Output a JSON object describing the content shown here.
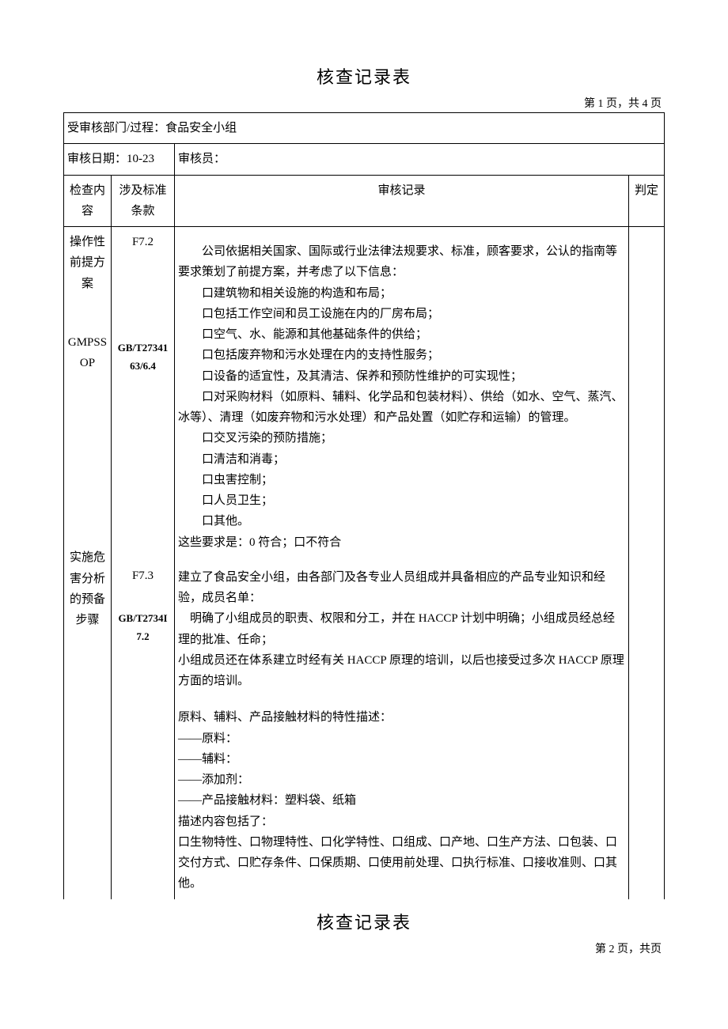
{
  "title": "核查记录表",
  "page_info_1": "第 1 页，共 4 页",
  "header": {
    "dept_label": "受审核部门/过程：",
    "dept_value": "食品安全小组",
    "date_label": "审核日期：",
    "date_value": "10-23",
    "auditor_label": "审核员："
  },
  "columns": {
    "check": "检查内容",
    "standard": "涉及标准条款",
    "record": "审核记录",
    "judge": "判定"
  },
  "row1": {
    "check_line1": "操作性",
    "check_line2": "前提方",
    "check_line3": "案",
    "check_line4": "GMPSS",
    "check_line5": "OP",
    "std_line1": "F7.2",
    "std_line2": "GB/T27341",
    "std_line3": "63/6.4",
    "rec_p1": "公司依据相关国家、国际或行业法律法规要求、标准，顾客要求，公认的指南等要求策划了前提方案，并考虑了以下信息：",
    "rec_b1": "口建筑物和相关设施的构造和布局；",
    "rec_b2": "口包括工作空间和员工设施在内的厂房布局；",
    "rec_b3": "口空气、水、能源和其他基础条件的供给；",
    "rec_b4": "口包括废弃物和污水处理在内的支持性服务；",
    "rec_b5": "口设备的适宜性，及其清洁、保养和预防性维护的可实现性；",
    "rec_b6": "口对采购材料（如原料、辅料、化学品和包装材料）、供给（如水、空气、蒸汽、冰等）、清理（如废弃物和污水处理）和产品处置（如贮存和运输）的管理。",
    "rec_b7": "口交叉污染的预防措施；",
    "rec_b8": "口清洁和消毒；",
    "rec_b9": "口虫害控制；",
    "rec_b10": "口人员卫生；",
    "rec_b11": "口其他。",
    "rec_p2": "这些要求是：0 符合；口不符合"
  },
  "row2": {
    "check_line1": "实施危",
    "check_line2": "害分析",
    "check_line3": "的预备",
    "check_line4": "步骤",
    "std_line1": "F7.3",
    "std_line2": "GB/T2734I",
    "std_line3": "7.2",
    "rec_p1": "建立了食品安全小组，由各部门及各专业人员组成并具备相应的产品专业知识和经验，成员名单：",
    "rec_p2": "　明确了小组成员的职责、权限和分工，并在 HACCP 计划中明确；小组成员经总经理的批准、任命；",
    "rec_p3": "小组成员还在体系建立时经有关 HACCP 原理的培训，以后也接受过多次 HACCP 原理方面的培训。",
    "rec_p4": "原料、辅料、产品接触材料的特性描述：",
    "rec_l1": "——原料：",
    "rec_l2": "——辅料：",
    "rec_l3": "——添加剂：",
    "rec_l4": "——产品接触材料：塑料袋、纸箱",
    "rec_p5": "描述内容包括了：",
    "rec_p6": "口生物特性、口物理特性、口化学特性、口组成、口产地、口生产方法、口包装、口交付方式、口贮存条件、口保质期、口使用前处理、口执行标准、口接收准则、口其他。"
  },
  "title2": "核查记录表",
  "page_info_2": "第 2 页，共页"
}
